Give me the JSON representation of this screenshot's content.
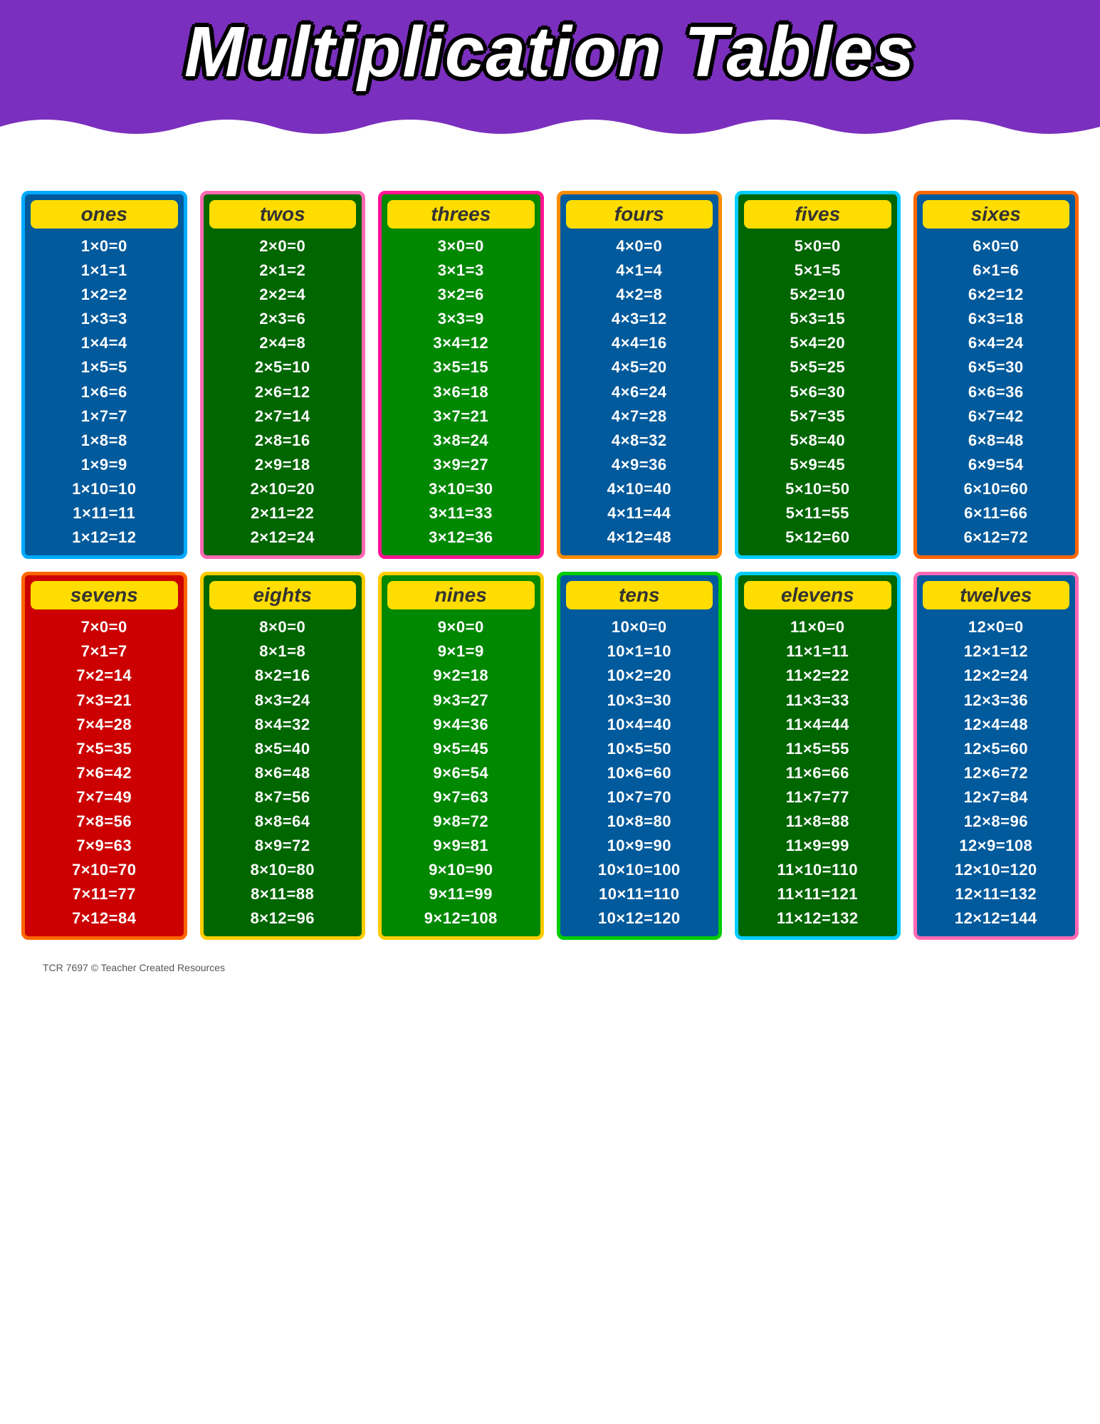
{
  "header": {
    "title": "Multiplication Tables",
    "bg_color": "#7b2fbe"
  },
  "footer": {
    "text": "TCR 7697  © Teacher Created Resources"
  },
  "tables": [
    {
      "id": "ones",
      "label": "ones",
      "card_class": "card-ones",
      "rows": [
        "1×0=0",
        "1×1=1",
        "1×2=2",
        "1×3=3",
        "1×4=4",
        "1×5=5",
        "1×6=6",
        "1×7=7",
        "1×8=8",
        "1×9=9",
        "1×10=10",
        "1×11=11",
        "1×12=12"
      ]
    },
    {
      "id": "twos",
      "label": "twos",
      "card_class": "card-twos",
      "rows": [
        "2×0=0",
        "2×1=2",
        "2×2=4",
        "2×3=6",
        "2×4=8",
        "2×5=10",
        "2×6=12",
        "2×7=14",
        "2×8=16",
        "2×9=18",
        "2×10=20",
        "2×11=22",
        "2×12=24"
      ]
    },
    {
      "id": "threes",
      "label": "threes",
      "card_class": "card-threes",
      "rows": [
        "3×0=0",
        "3×1=3",
        "3×2=6",
        "3×3=9",
        "3×4=12",
        "3×5=15",
        "3×6=18",
        "3×7=21",
        "3×8=24",
        "3×9=27",
        "3×10=30",
        "3×11=33",
        "3×12=36"
      ]
    },
    {
      "id": "fours",
      "label": "fours",
      "card_class": "card-fours",
      "rows": [
        "4×0=0",
        "4×1=4",
        "4×2=8",
        "4×3=12",
        "4×4=16",
        "4×5=20",
        "4×6=24",
        "4×7=28",
        "4×8=32",
        "4×9=36",
        "4×10=40",
        "4×11=44",
        "4×12=48"
      ]
    },
    {
      "id": "fives",
      "label": "fives",
      "card_class": "card-fives",
      "rows": [
        "5×0=0",
        "5×1=5",
        "5×2=10",
        "5×3=15",
        "5×4=20",
        "5×5=25",
        "5×6=30",
        "5×7=35",
        "5×8=40",
        "5×9=45",
        "5×10=50",
        "5×11=55",
        "5×12=60"
      ]
    },
    {
      "id": "sixes",
      "label": "sixes",
      "card_class": "card-sixes",
      "rows": [
        "6×0=0",
        "6×1=6",
        "6×2=12",
        "6×3=18",
        "6×4=24",
        "6×5=30",
        "6×6=36",
        "6×7=42",
        "6×8=48",
        "6×9=54",
        "6×10=60",
        "6×11=66",
        "6×12=72"
      ]
    },
    {
      "id": "sevens",
      "label": "sevens",
      "card_class": "card-sevens",
      "rows": [
        "7×0=0",
        "7×1=7",
        "7×2=14",
        "7×3=21",
        "7×4=28",
        "7×5=35",
        "7×6=42",
        "7×7=49",
        "7×8=56",
        "7×9=63",
        "7×10=70",
        "7×11=77",
        "7×12=84"
      ]
    },
    {
      "id": "eights",
      "label": "eights",
      "card_class": "card-eights",
      "rows": [
        "8×0=0",
        "8×1=8",
        "8×2=16",
        "8×3=24",
        "8×4=32",
        "8×5=40",
        "8×6=48",
        "8×7=56",
        "8×8=64",
        "8×9=72",
        "8×10=80",
        "8×11=88",
        "8×12=96"
      ]
    },
    {
      "id": "nines",
      "label": "nines",
      "card_class": "card-nines",
      "rows": [
        "9×0=0",
        "9×1=9",
        "9×2=18",
        "9×3=27",
        "9×4=36",
        "9×5=45",
        "9×6=54",
        "9×7=63",
        "9×8=72",
        "9×9=81",
        "9×10=90",
        "9×11=99",
        "9×12=108"
      ]
    },
    {
      "id": "tens",
      "label": "tens",
      "card_class": "card-tens",
      "rows": [
        "10×0=0",
        "10×1=10",
        "10×2=20",
        "10×3=30",
        "10×4=40",
        "10×5=50",
        "10×6=60",
        "10×7=70",
        "10×8=80",
        "10×9=90",
        "10×10=100",
        "10×11=110",
        "10×12=120"
      ]
    },
    {
      "id": "elevens",
      "label": "elevens",
      "card_class": "card-elevens",
      "rows": [
        "11×0=0",
        "11×1=11",
        "11×2=22",
        "11×3=33",
        "11×4=44",
        "11×5=55",
        "11×6=66",
        "11×7=77",
        "11×8=88",
        "11×9=99",
        "11×10=110",
        "11×11=121",
        "11×12=132"
      ]
    },
    {
      "id": "twelves",
      "label": "twelves",
      "card_class": "card-twelves",
      "rows": [
        "12×0=0",
        "12×1=12",
        "12×2=24",
        "12×3=36",
        "12×4=48",
        "12×5=60",
        "12×6=72",
        "12×7=84",
        "12×8=96",
        "12×9=108",
        "12×10=120",
        "12×11=132",
        "12×12=144"
      ]
    }
  ]
}
